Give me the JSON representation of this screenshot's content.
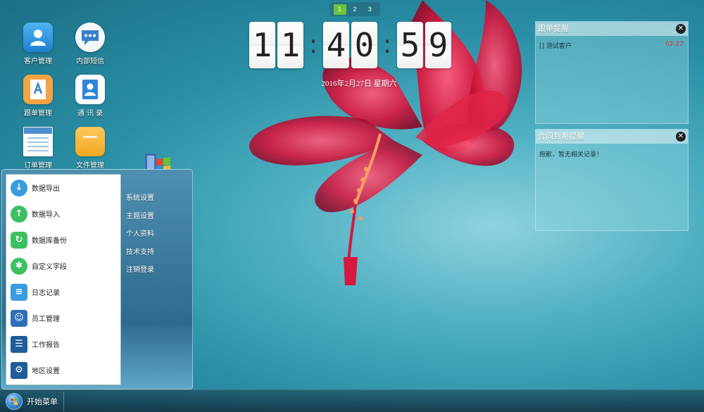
{
  "page_switcher": {
    "pages": [
      "1",
      "2",
      "3"
    ],
    "active_index": 0
  },
  "clock": {
    "hour": [
      "1",
      "1"
    ],
    "minute": [
      "4",
      "0"
    ],
    "second": [
      "5",
      "9"
    ],
    "separator": ":",
    "date": "2016年2月27日  星期六"
  },
  "desktop_icons": {
    "customer": "客户管理",
    "message": "内部短信",
    "followup": "跟单管理",
    "contacts": "通 讯 录",
    "orders": "订单管理",
    "files": "文件管理"
  },
  "panels": {
    "followup": {
      "title": "跟单提醒",
      "close": "✕",
      "rows": [
        {
          "name": "[] 测试客户",
          "date": "02-27"
        }
      ]
    },
    "contract": {
      "title": "合同到期提醒",
      "close": "✕",
      "empty_text": "抱歉，暂无相关记录！"
    }
  },
  "start_menu": {
    "left_items": [
      {
        "label": "数据导出",
        "icon": "download-icon",
        "color": "#3a9be0"
      },
      {
        "label": "数据导入",
        "icon": "upload-icon",
        "color": "#3cc061"
      },
      {
        "label": "数据库备份",
        "icon": "refresh-icon",
        "color": "#3cc061"
      },
      {
        "label": "自定义字段",
        "icon": "gear-icon",
        "color": "#3cc061"
      },
      {
        "label": "日志记录",
        "icon": "log-icon",
        "color": "#3a9be0"
      },
      {
        "label": "员工管理",
        "icon": "staff-icon",
        "color": "#2d6fb8"
      },
      {
        "label": "工作报告",
        "icon": "report-icon",
        "color": "#1f5c99"
      },
      {
        "label": "地区设置",
        "icon": "settings-icon",
        "color": "#1f5c99"
      }
    ],
    "right_items": [
      "系统设置",
      "主题设置",
      "个人资料",
      "技术支持",
      "注销登录"
    ]
  },
  "taskbar": {
    "start_label": "开始菜单"
  },
  "colors": {
    "accent_green": "#6cc33a",
    "date_red": "#e03030"
  }
}
